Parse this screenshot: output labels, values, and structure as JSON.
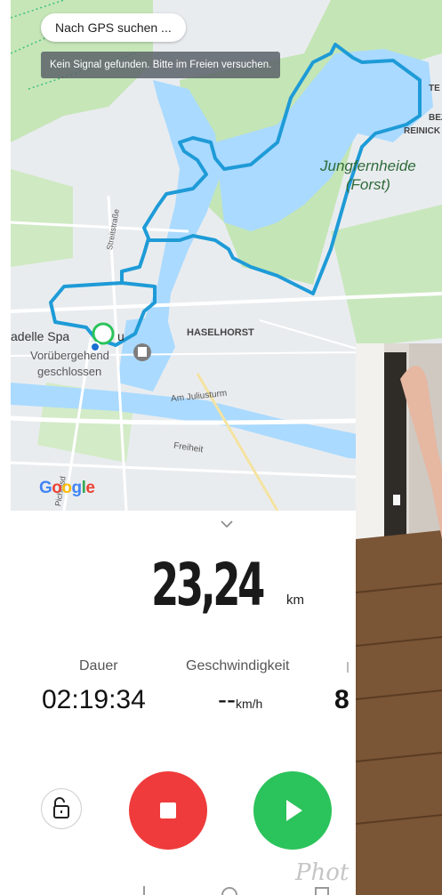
{
  "map": {
    "gps_status": "Nach GPS suchen ...",
    "signal_toast": "Kein Signal gefunden. Bitte im Freien versuchen.",
    "labels": {
      "haselhorst": "HASELHORST",
      "zitadelle": "adelle Spa",
      "zitadelle_tail": "u",
      "voruebergehend": "Vorübergehend",
      "geschlossen": "geschlossen",
      "am_juliusturm": "Am Juliusturm",
      "freiheit": "Freiheit",
      "streitstrasse": "Streitstraße",
      "te": "TE",
      "bez": "BEZ",
      "reinick": "REINICK",
      "pichelsdorfer": "Pichelsd"
    },
    "forest": {
      "line1": "Jungfernheide",
      "line2": "(Forst)"
    },
    "attribution": [
      "G",
      "o",
      "o",
      "g",
      "l",
      "e"
    ]
  },
  "workout": {
    "distance_value": "23,24",
    "distance_unit": "km",
    "duration_label": "Dauer",
    "duration_value": "02:19:34",
    "speed_label": "Geschwindigkeit",
    "speed_value": "--",
    "speed_unit": "km/h",
    "third_value": "8"
  },
  "colors": {
    "route": "#1e9bd7",
    "stop": "#ef3b3b",
    "play": "#2bc35b",
    "water": "#aadaff",
    "park": "#c4e5b5"
  },
  "icons": {
    "collapse": "chevron-down-icon",
    "lock": "unlock-icon",
    "stop": "stop-icon",
    "play": "play-icon"
  },
  "watermark": "Phot"
}
